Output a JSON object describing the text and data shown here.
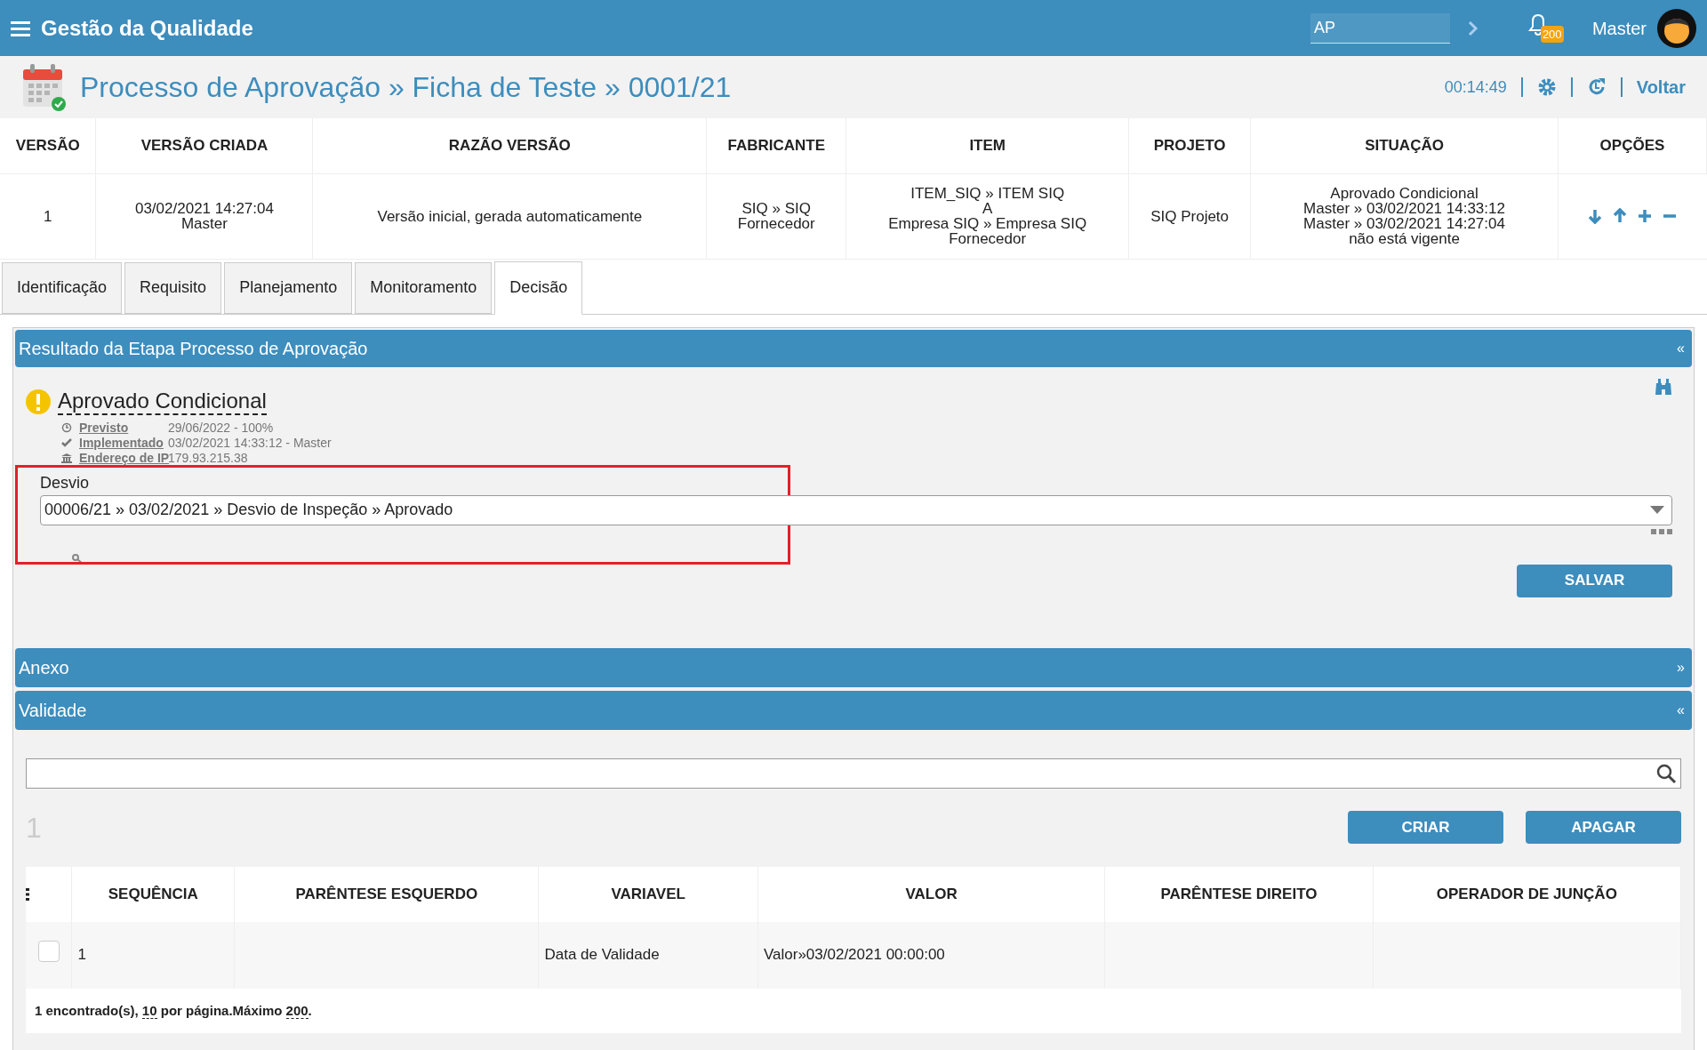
{
  "app_bar": {
    "title": "Gestão da Qualidade",
    "search_value": "AP",
    "notification_count": "200",
    "user": "Master"
  },
  "page_header": {
    "breadcrumb": "Processo de Aprovação » Ficha de Teste » 0001/21",
    "timer": "00:14:49",
    "back_link": "Voltar"
  },
  "version_table": {
    "columns": [
      "VERSÃO",
      "VERSÃO CRIADA",
      "RAZÃO VERSÃO",
      "FABRICANTE",
      "ITEM",
      "PROJETO",
      "SITUAÇÃO",
      "OPÇÕES"
    ],
    "row": [
      [
        "1"
      ],
      [
        "03/02/2021 14:27:04",
        "Master"
      ],
      [
        "Versão inicial, gerada automaticamente"
      ],
      [
        "SIQ » SIQ",
        "Fornecedor"
      ],
      [
        "ITEM_SIQ » ITEM SIQ",
        "A",
        "Empresa SIQ » Empresa SIQ",
        "Fornecedor"
      ],
      [
        "SIQ Projeto"
      ],
      [
        "Aprovado Condicional",
        "Master » 03/02/2021 14:33:12",
        "Master » 03/02/2021 14:27:04",
        "não está vigente"
      ]
    ]
  },
  "tabs": [
    {
      "label": "Identificação",
      "selected": false
    },
    {
      "label": "Requisito",
      "selected": false
    },
    {
      "label": "Planejamento",
      "selected": false
    },
    {
      "label": "Monitoramento",
      "selected": false
    },
    {
      "label": "Decisão",
      "selected": true
    }
  ],
  "result_section": {
    "title": "Resultado da Etapa Processo de Aprovação",
    "toggle": "«",
    "status": "Aprovado Condicional",
    "details": [
      {
        "kind": "planned",
        "label": "Previsto",
        "value": "29/06/2022 - 100%"
      },
      {
        "kind": "done",
        "label": "Implementado",
        "value": "03/02/2021 14:33:12 - Master"
      },
      {
        "kind": "ip",
        "label": "Endereço de IP",
        "value": "179.93.215.38"
      }
    ],
    "field_label": "Desvio",
    "field_value": "00006/21 » 03/02/2021 » Desvio de Inspeção » Aprovado",
    "save_button": "SALVAR"
  },
  "attachment_section": {
    "title": "Anexo",
    "toggle": "»"
  },
  "validity_section": {
    "title": "Validade",
    "toggle": "«",
    "count": "1",
    "buttons": [
      "CRIAR",
      "APAGAR"
    ],
    "columns": [
      "SEQUÊNCIA",
      "PARÊNTESE ESQUERDO",
      "VARIAVEL",
      "VALOR",
      "PARÊNTESE DIREITO",
      "OPERADOR DE JUNÇÃO"
    ],
    "rows": [
      {
        "checked": false,
        "cells": [
          "1",
          "",
          "Data de Validade",
          "Valor»03/02/2021 00:00:00",
          "",
          ""
        ]
      }
    ],
    "footer": {
      "found": "1 encontrado(s),",
      "page_size": "10",
      "per_page": "por página.Máximo",
      "max": "200",
      "end": "."
    }
  }
}
